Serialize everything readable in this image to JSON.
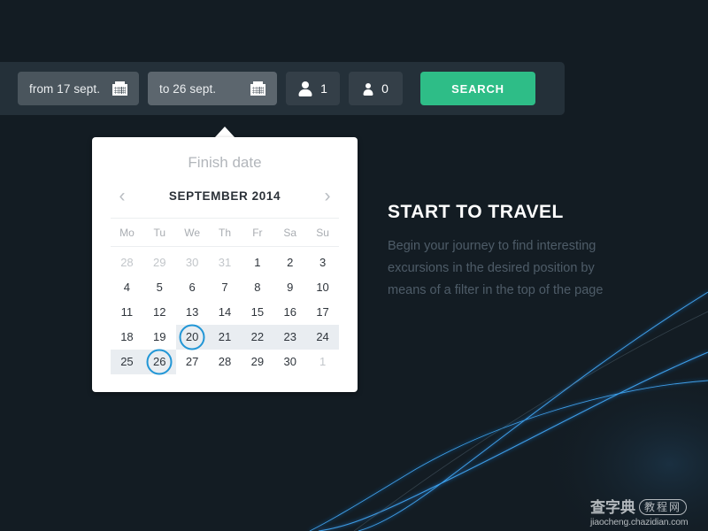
{
  "page": {
    "background_color": "#131c23",
    "accent_color": "#2ebd87",
    "highlight_color": "#2196d6"
  },
  "toolbar": {
    "from_field": {
      "icon": "calendar-icon",
      "value": "from 17 sept.",
      "state": "inactive"
    },
    "to_field": {
      "icon": "calendar-icon",
      "value": "to 26 sept.",
      "state": "active"
    },
    "adults": {
      "icon": "person-adult-icon",
      "value": "1"
    },
    "children": {
      "icon": "person-child-icon",
      "value": "0"
    },
    "search_label": "SEARCH"
  },
  "datepicker": {
    "title": "Finish date",
    "prev_icon": "chevron-left-icon",
    "next_icon": "chevron-right-icon",
    "month_label": "SEPTEMBER 2014",
    "weekdays": [
      "Mo",
      "Tu",
      "We",
      "Th",
      "Fr",
      "Sa",
      "Su"
    ],
    "weeks": [
      [
        {
          "n": "28",
          "muted": true
        },
        {
          "n": "29",
          "muted": true
        },
        {
          "n": "30",
          "muted": true
        },
        {
          "n": "31",
          "muted": true
        },
        {
          "n": "1",
          "muted": false
        },
        {
          "n": "2",
          "muted": false
        },
        {
          "n": "3",
          "muted": false
        }
      ],
      [
        {
          "n": "4",
          "muted": false
        },
        {
          "n": "5",
          "muted": false
        },
        {
          "n": "6",
          "muted": false
        },
        {
          "n": "7",
          "muted": false
        },
        {
          "n": "8",
          "muted": false
        },
        {
          "n": "9",
          "muted": false
        },
        {
          "n": "10",
          "muted": false
        }
      ],
      [
        {
          "n": "11",
          "muted": false
        },
        {
          "n": "12",
          "muted": false
        },
        {
          "n": "13",
          "muted": false
        },
        {
          "n": "14",
          "muted": false
        },
        {
          "n": "15",
          "muted": false
        },
        {
          "n": "16",
          "muted": false
        },
        {
          "n": "17",
          "muted": false
        }
      ],
      [
        {
          "n": "18",
          "muted": false
        },
        {
          "n": "19",
          "muted": false
        },
        {
          "n": "20",
          "muted": false,
          "selected": true,
          "in_range": true
        },
        {
          "n": "21",
          "muted": false,
          "in_range": true
        },
        {
          "n": "22",
          "muted": false,
          "in_range": true
        },
        {
          "n": "23",
          "muted": false,
          "in_range": true
        },
        {
          "n": "24",
          "muted": false,
          "in_range": true
        }
      ],
      [
        {
          "n": "25",
          "muted": false,
          "in_range": true
        },
        {
          "n": "26",
          "muted": false,
          "selected": true,
          "in_range": true
        },
        {
          "n": "27",
          "muted": false
        },
        {
          "n": "28",
          "muted": false
        },
        {
          "n": "29",
          "muted": false
        },
        {
          "n": "30",
          "muted": false
        },
        {
          "n": "1",
          "muted": true
        }
      ]
    ],
    "range_start_day": "20",
    "range_end_day": "26"
  },
  "hero": {
    "title": "START TO TRAVEL",
    "body": "Begin your journey to find interesting excursions in the desired position by means of a filter in the top of the page"
  },
  "watermark": {
    "brand": "查字典",
    "section": "教程网",
    "url": "jiaocheng.chazidian.com"
  }
}
